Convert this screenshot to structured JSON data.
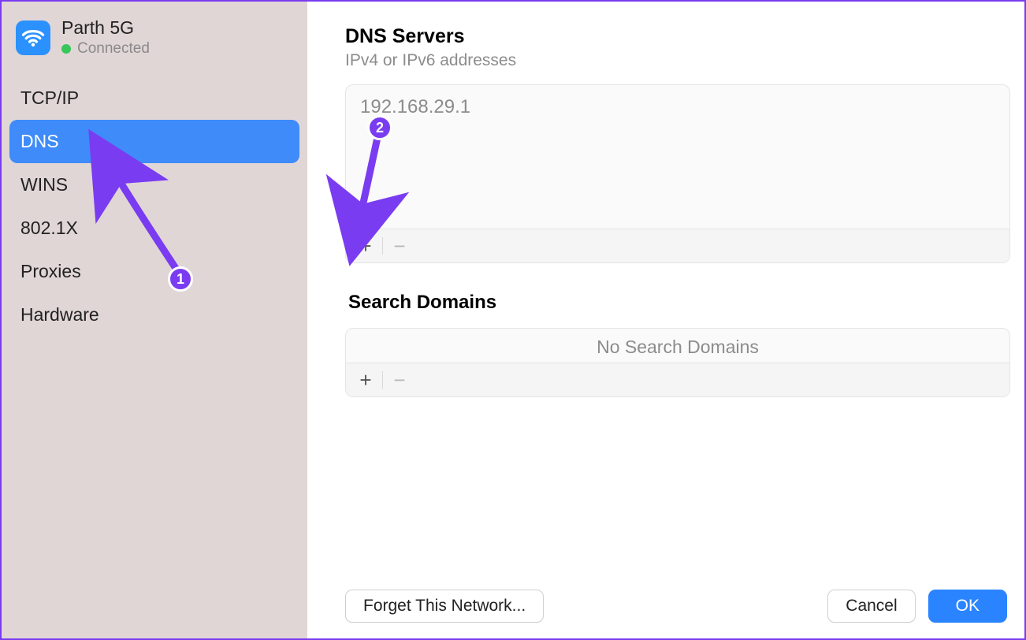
{
  "sidebar": {
    "network_name": "Parth 5G",
    "status_label": "Connected",
    "items": [
      {
        "label": "TCP/IP",
        "selected": false
      },
      {
        "label": "DNS",
        "selected": true
      },
      {
        "label": "WINS",
        "selected": false
      },
      {
        "label": "802.1X",
        "selected": false
      },
      {
        "label": "Proxies",
        "selected": false
      },
      {
        "label": "Hardware",
        "selected": false
      }
    ]
  },
  "dns": {
    "title": "DNS Servers",
    "subtitle": "IPv4 or IPv6 addresses",
    "entries": [
      "192.168.29.1"
    ],
    "add_label": "+",
    "remove_label": "−"
  },
  "search_domains": {
    "title": "Search Domains",
    "placeholder": "No Search Domains",
    "add_label": "+",
    "remove_label": "−"
  },
  "footer": {
    "forget_label": "Forget This Network...",
    "cancel_label": "Cancel",
    "ok_label": "OK"
  },
  "annotations": {
    "badge1": "1",
    "badge2": "2"
  }
}
